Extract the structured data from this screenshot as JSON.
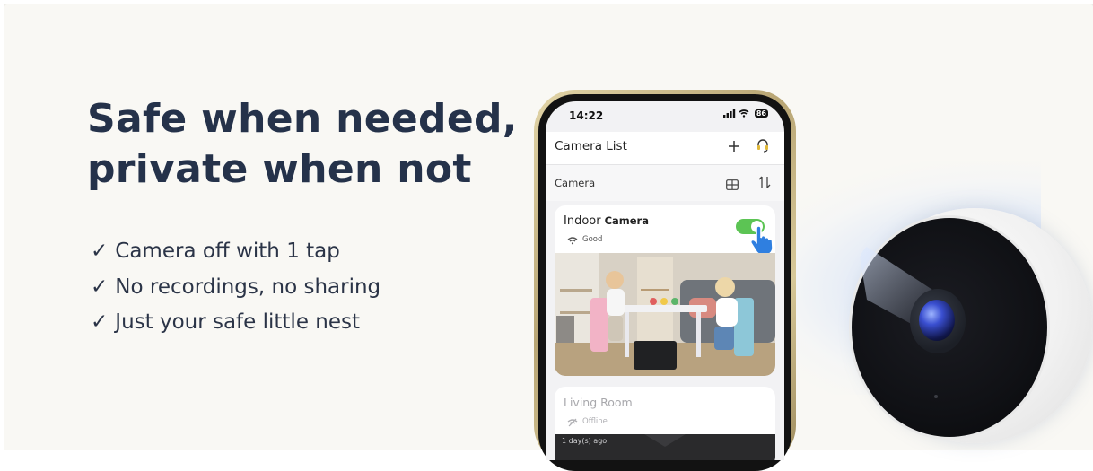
{
  "headline": {
    "line1": "Safe when needed,",
    "line2": "private when not"
  },
  "features": [
    {
      "check": "✓",
      "text": "Camera off with 1 tap"
    },
    {
      "check": "✓",
      "text": "No recordings, no sharing"
    },
    {
      "check": "✓",
      "text": "Just your safe little nest"
    }
  ],
  "phone": {
    "status_time": "14:22",
    "signal": "∥∥",
    "battery": "86",
    "screen_title": "Camera List",
    "add_icon": "plus-icon",
    "support_icon": "headset-icon",
    "section_label": "Camera",
    "grid_icon": "grid-view-icon",
    "sort_icon": "sort-icon",
    "cameras": [
      {
        "name_word1": "Indoor",
        "name_word2": "Camera",
        "status": "Good",
        "status_icon": "wifi-icon",
        "toggle_on": true,
        "toggle_color": "#5cc454"
      },
      {
        "name": "Living Room",
        "status": "Offline",
        "status_icon": "wifi-off-icon",
        "last_seen": "1 day(s) ago"
      }
    ]
  },
  "colors": {
    "background": "#f9f8f4",
    "headline": "#25324a",
    "body_text": "#2b3447",
    "phone_frame": "#c8b98a"
  }
}
